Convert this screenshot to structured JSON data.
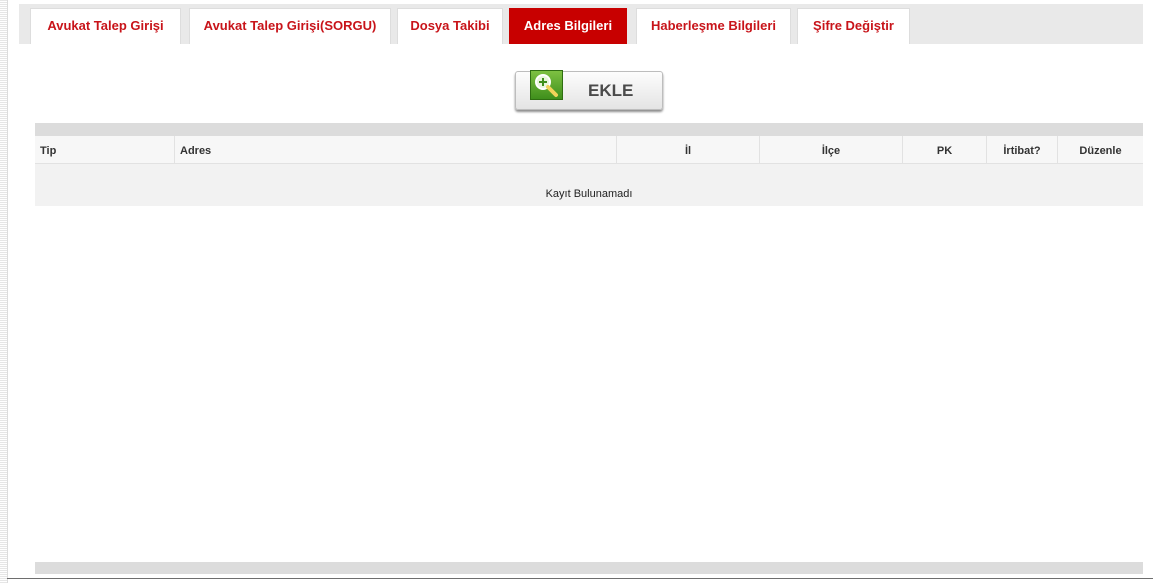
{
  "tabs": [
    {
      "label": "Avukat Talep Girişi",
      "active": false
    },
    {
      "label": "Avukat Talep Girişi(SORGU)",
      "active": false
    },
    {
      "label": "Dosya Takibi",
      "active": false
    },
    {
      "label": "Adres Bilgileri",
      "active": true
    },
    {
      "label": "Haberleşme Bilgileri",
      "active": false
    },
    {
      "label": "Şifre Değiştir",
      "active": false
    }
  ],
  "add_button": {
    "label": "EKLE",
    "icon": "zoom-plus-icon"
  },
  "grid": {
    "columns": [
      "Tip",
      "Adres",
      "İl",
      "İlçe",
      "PK",
      "İrtibat?",
      "Düzenle"
    ],
    "empty_message": "Kayıt Bulunamadı"
  },
  "colors": {
    "accent": "#c80000",
    "tab_text": "#c8141a",
    "icon_green": "#4fa02a"
  }
}
